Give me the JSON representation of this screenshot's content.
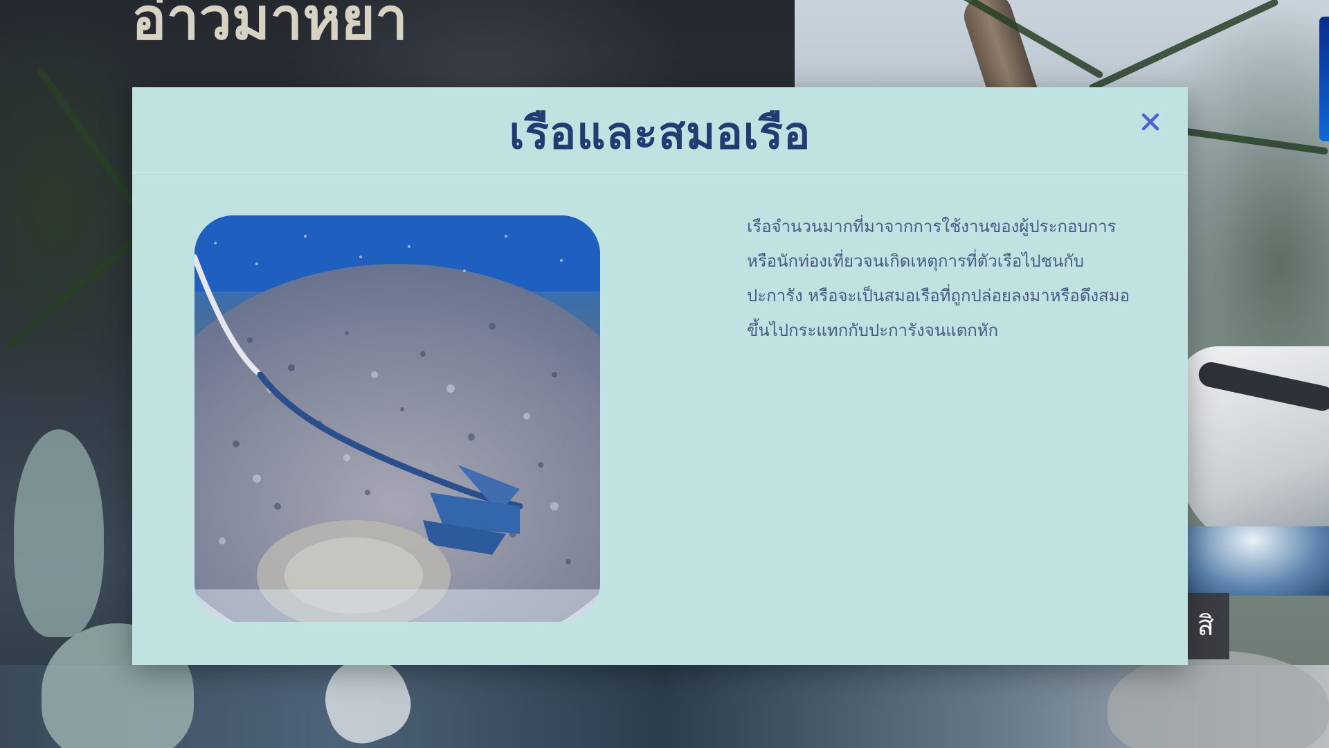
{
  "background": {
    "title_text": "อ่าวมาหยา",
    "button_label": "สิ"
  },
  "modal": {
    "title": "เรือและสมอเรือ",
    "close_icon": "close-icon",
    "image_icon": "anchor-on-coral-photo",
    "description": "เรือจำนวนมากที่มาจากการใช้งานของผู้ประกอบการหรือนักท่องเที่ยวจนเกิดเหตุการที่ตัวเรือไปชนกับปะการัง หรือจะเป็นสมอเรือที่ถูกปล่อยลงมาหรือดึงสมอขึ้นไปกระแทกกับปะการังจนแตกหัก"
  },
  "colors": {
    "modal_bg": "#c0e3e1",
    "title": "#243a72",
    "close": "#4f63d6",
    "text": "#4a5a86"
  }
}
